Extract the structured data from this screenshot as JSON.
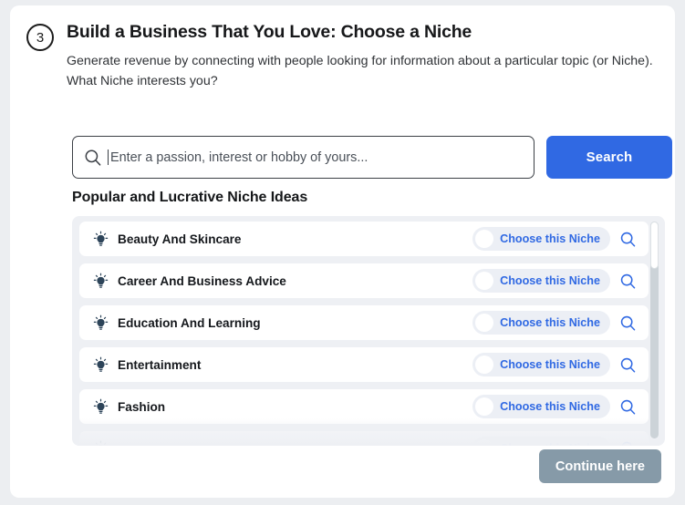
{
  "colors": {
    "accent_blue": "#3069e3",
    "page_bg": "#eceef1",
    "card_bg": "#ffffff",
    "list_bg": "#eef0f4",
    "pill_bg": "#eceff5",
    "continue_btn": "#869aa8",
    "heading_text": "#17181a"
  },
  "header": {
    "step_number": "3",
    "title": "Build a Business That You Love: Choose a Niche",
    "subtitle": "Generate revenue by connecting with people looking for information about a particular topic (or Niche). What Niche interests you?"
  },
  "search": {
    "icon": "search-icon",
    "value": "",
    "placeholder": "Enter a passion, interest or hobby of yours...",
    "button_label": "Search"
  },
  "list": {
    "heading": "Popular and Lucrative Niche Ideas",
    "choose_label": "Choose this Niche",
    "item_icon": "lightbulb-icon",
    "row_action_icon": "search-icon",
    "items": [
      {
        "label": "Beauty And Skincare",
        "selected": false
      },
      {
        "label": "Career And Business Advice",
        "selected": false
      },
      {
        "label": "Education And Learning",
        "selected": false
      },
      {
        "label": "Entertainment",
        "selected": false
      },
      {
        "label": "Fashion",
        "selected": false
      },
      {
        "label": "",
        "selected": false
      }
    ]
  },
  "footer": {
    "continue_label": "Continue here"
  }
}
